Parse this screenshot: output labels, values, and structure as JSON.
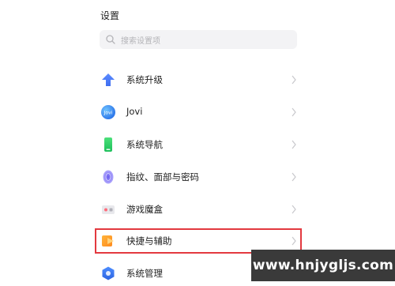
{
  "header": {
    "title": "设置"
  },
  "search": {
    "placeholder": "搜索设置项"
  },
  "items": [
    {
      "label": "系统升级",
      "icon": "upgrade-arrow-icon"
    },
    {
      "label": "Jovi",
      "icon": "jovi-icon"
    },
    {
      "label": "系统导航",
      "icon": "navigation-phone-icon"
    },
    {
      "label": "指纹、面部与密码",
      "icon": "fingerprint-icon"
    },
    {
      "label": "游戏魔盒",
      "icon": "game-box-icon"
    },
    {
      "label": "快捷与辅助",
      "icon": "shortcut-arrow-icon",
      "highlighted": true
    },
    {
      "label": "系统管理",
      "icon": "system-management-icon"
    }
  ],
  "jovi_icon_text": "Jovi",
  "highlight_color": "#e3393f",
  "watermark": {
    "text": "www.hnjygljs.com"
  }
}
